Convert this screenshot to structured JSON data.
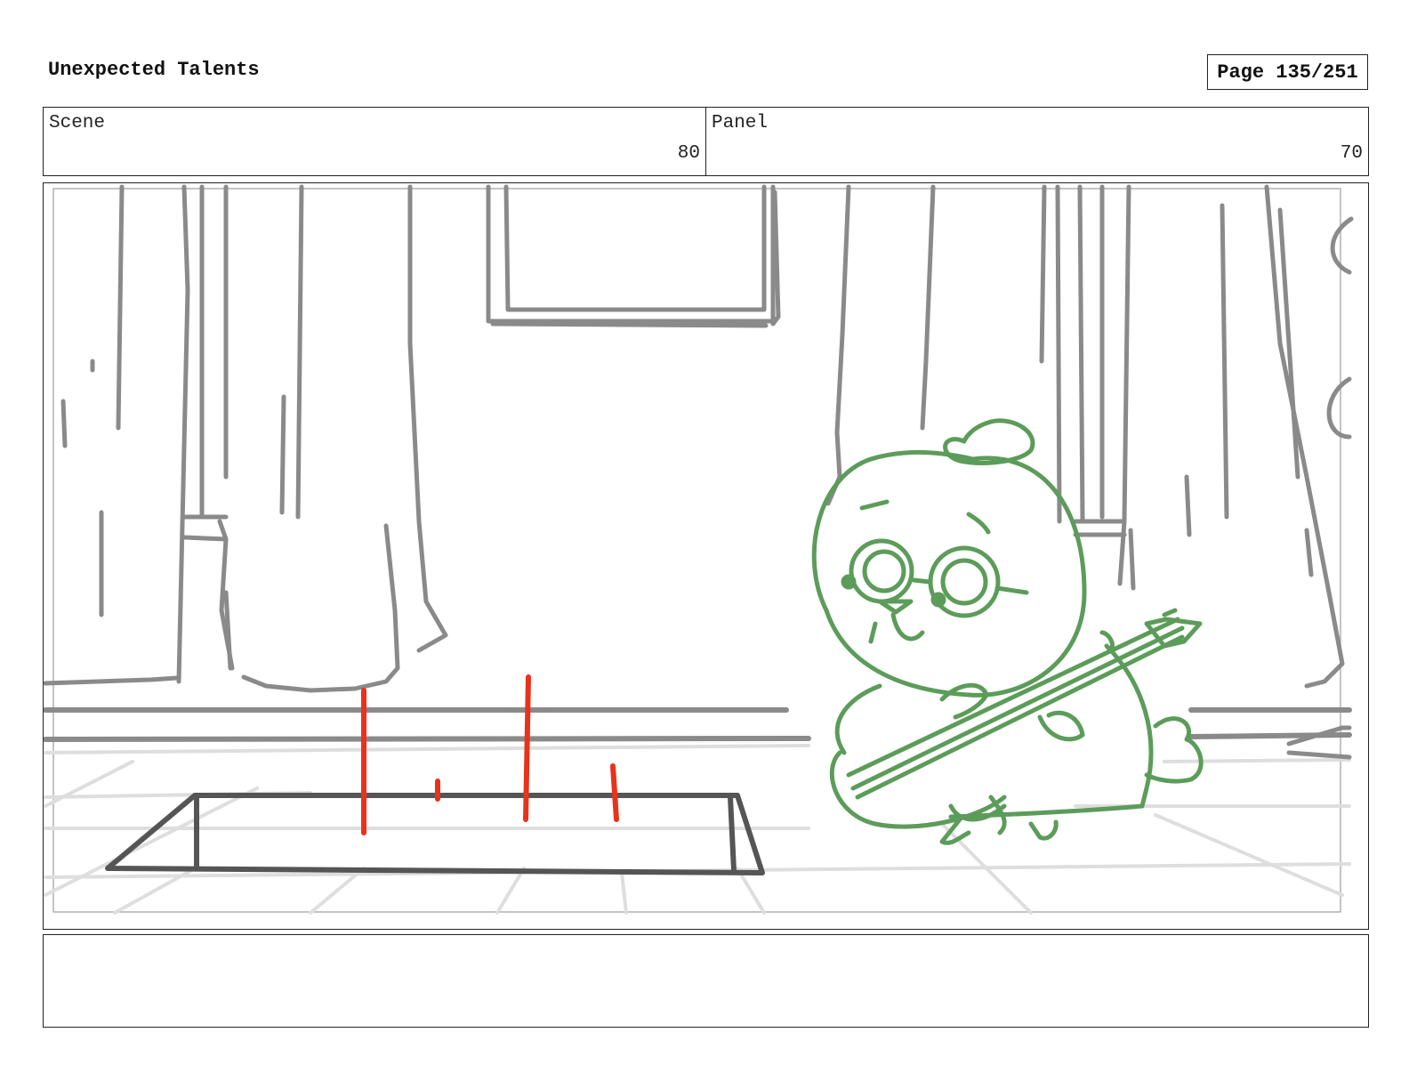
{
  "header": {
    "title": "Unexpected Talents",
    "page": "Page 135/251"
  },
  "info": {
    "scene_label": "Scene",
    "scene_value": "80",
    "panel_label": "Panel",
    "panel_value": "70"
  },
  "notes": {
    "text": ""
  },
  "colors": {
    "sketch_gray": "#8a8a8a",
    "character_green": "#5c9c5a",
    "annotation_red": "#e8321c",
    "floor_light": "#dddddd"
  }
}
